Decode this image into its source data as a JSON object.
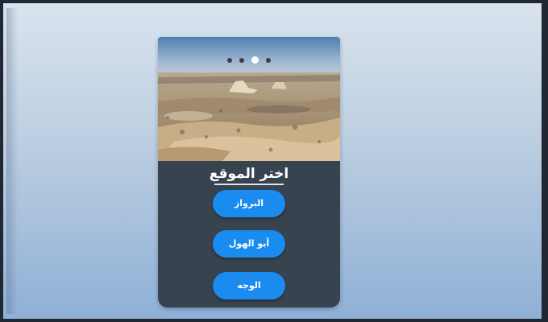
{
  "panel": {
    "title": "اختر الموقع",
    "carousel": {
      "count": 4,
      "active_index": 2
    },
    "photo_icon": "desert-landscape-photo",
    "buttons": [
      {
        "label": "البرواز"
      },
      {
        "label": "أبو الهول"
      },
      {
        "label": "الوجه"
      }
    ]
  },
  "colors": {
    "background": "#b7cbe0",
    "panel": "#384350",
    "button": "#1a8cf0",
    "text": "#ffffff"
  }
}
